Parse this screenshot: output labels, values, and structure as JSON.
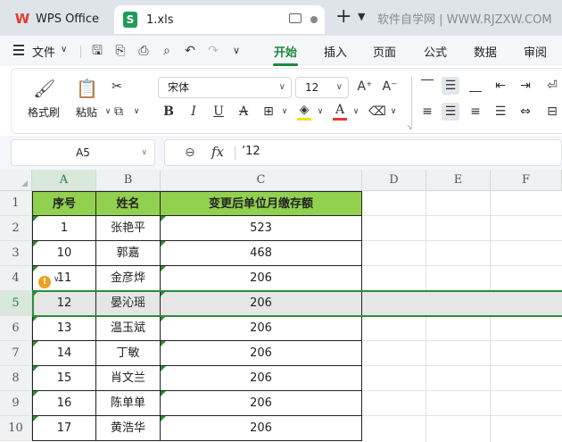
{
  "tabs": {
    "app_title": "WPS Office",
    "doc_title": "1.xls",
    "watermark": "软件自学网 | WWW.RJZXW.COM"
  },
  "menu": {
    "file": "文件",
    "tabs": [
      "开始",
      "插入",
      "页面",
      "公式",
      "数据",
      "审阅"
    ],
    "active_tab": "开始"
  },
  "ribbon": {
    "format_painter": "格式刷",
    "paste": "粘贴",
    "font_name": "宋体",
    "font_size": "12",
    "font_color": "#e53a2f",
    "highlight_color": "#f5e11b"
  },
  "formula_bar": {
    "cell_ref": "A5",
    "fx": "fx",
    "content": "’12"
  },
  "sheet": {
    "columns": [
      "A",
      "B",
      "C",
      "D",
      "E",
      "F"
    ],
    "rows": [
      "1",
      "2",
      "3",
      "4",
      "5",
      "6",
      "7",
      "8",
      "9",
      "10"
    ],
    "header_row": [
      "序号",
      "姓名",
      "变更后单位月缴存额"
    ],
    "data": [
      [
        "1",
        "张艳平",
        "523"
      ],
      [
        "10",
        "郭嘉",
        "468"
      ],
      [
        "11",
        "金彦烨",
        "206"
      ],
      [
        "12",
        "晏沁瑶",
        "206"
      ],
      [
        "13",
        "温玉斌",
        "206"
      ],
      [
        "14",
        "丁敏",
        "206"
      ],
      [
        "15",
        "肖文兰",
        "206"
      ],
      [
        "16",
        "陈单单",
        "206"
      ],
      [
        "17",
        "黄浩华",
        "206"
      ]
    ],
    "selected_row": "5",
    "header_fill": "#92d050",
    "accent": "#2f8a3a"
  }
}
